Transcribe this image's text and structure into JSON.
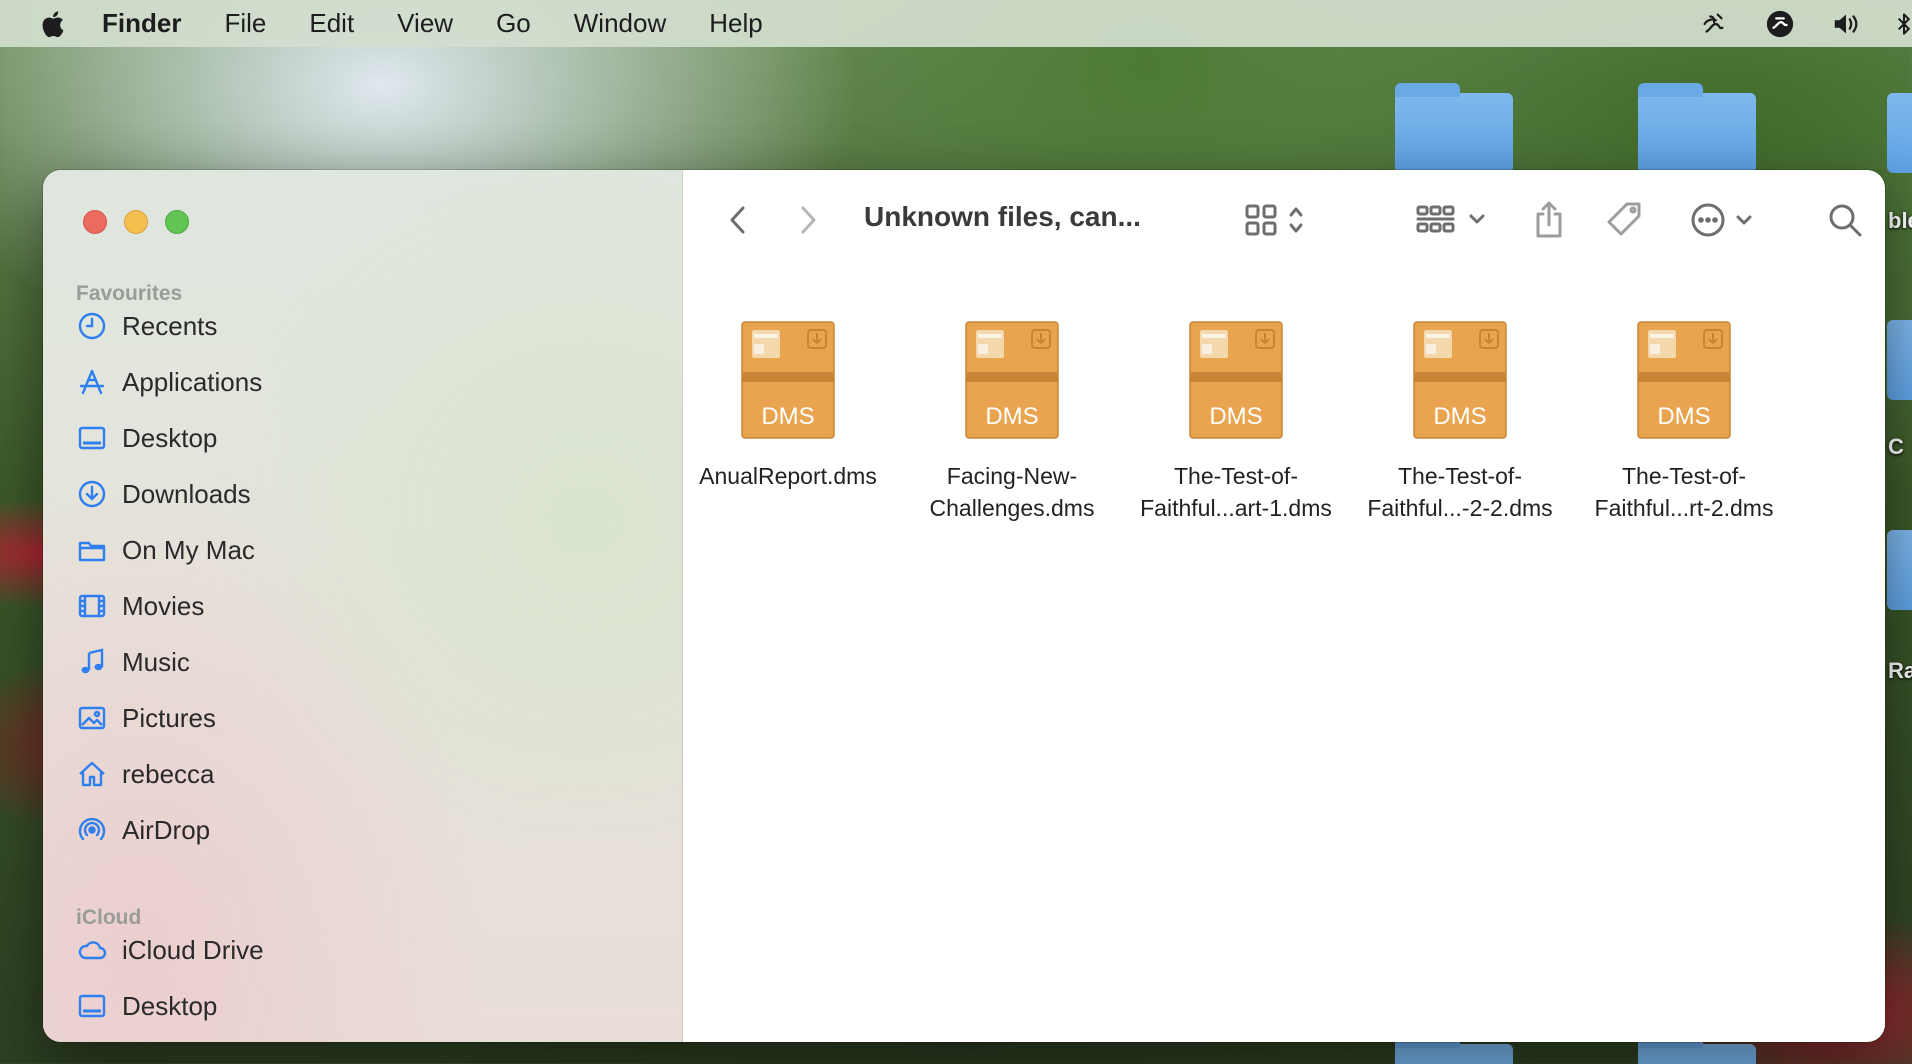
{
  "menubar": {
    "app_name": "Finder",
    "items": [
      "File",
      "Edit",
      "View",
      "Go",
      "Window",
      "Help"
    ],
    "status_icons": [
      "script-icon",
      "sync-icon",
      "volume-icon",
      "bluetooth-icon"
    ]
  },
  "toolbar": {
    "title": "Unknown files, can..."
  },
  "sidebar": {
    "favourites_heading": "Favourites",
    "favourites": [
      {
        "label": "Recents",
        "icon": "clock-icon"
      },
      {
        "label": "Applications",
        "icon": "applications-icon"
      },
      {
        "label": "Desktop",
        "icon": "desktop-icon"
      },
      {
        "label": "Downloads",
        "icon": "download-icon"
      },
      {
        "label": "On My Mac",
        "icon": "folder-icon"
      },
      {
        "label": "Movies",
        "icon": "film-icon"
      },
      {
        "label": "Music",
        "icon": "music-note-icon"
      },
      {
        "label": "Pictures",
        "icon": "photo-icon"
      },
      {
        "label": "rebecca",
        "icon": "home-icon"
      },
      {
        "label": "AirDrop",
        "icon": "airdrop-icon"
      }
    ],
    "icloud_heading": "iCloud",
    "icloud": [
      {
        "label": "iCloud Drive",
        "icon": "cloud-icon"
      },
      {
        "label": "Desktop",
        "icon": "desktop-icon"
      }
    ]
  },
  "files": [
    {
      "name": "AnualReport.dms",
      "badge": "DMS"
    },
    {
      "name": "Facing-New-\nChallenges.dms",
      "badge": "DMS"
    },
    {
      "name": "The-Test-of-\nFaithful...art-1.dms",
      "badge": "DMS"
    },
    {
      "name": "The-Test-of-\nFaithful...-2-2.dms",
      "badge": "DMS"
    },
    {
      "name": "The-Test-of-\nFaithful...rt-2.dms",
      "badge": "DMS"
    }
  ],
  "desktop_peek_labels": [
    "ble",
    "C",
    "Ra"
  ],
  "colors": {
    "accent": "#2f7ff0",
    "file_icon": "#e8a44e",
    "file_icon_dark": "#c78535"
  }
}
